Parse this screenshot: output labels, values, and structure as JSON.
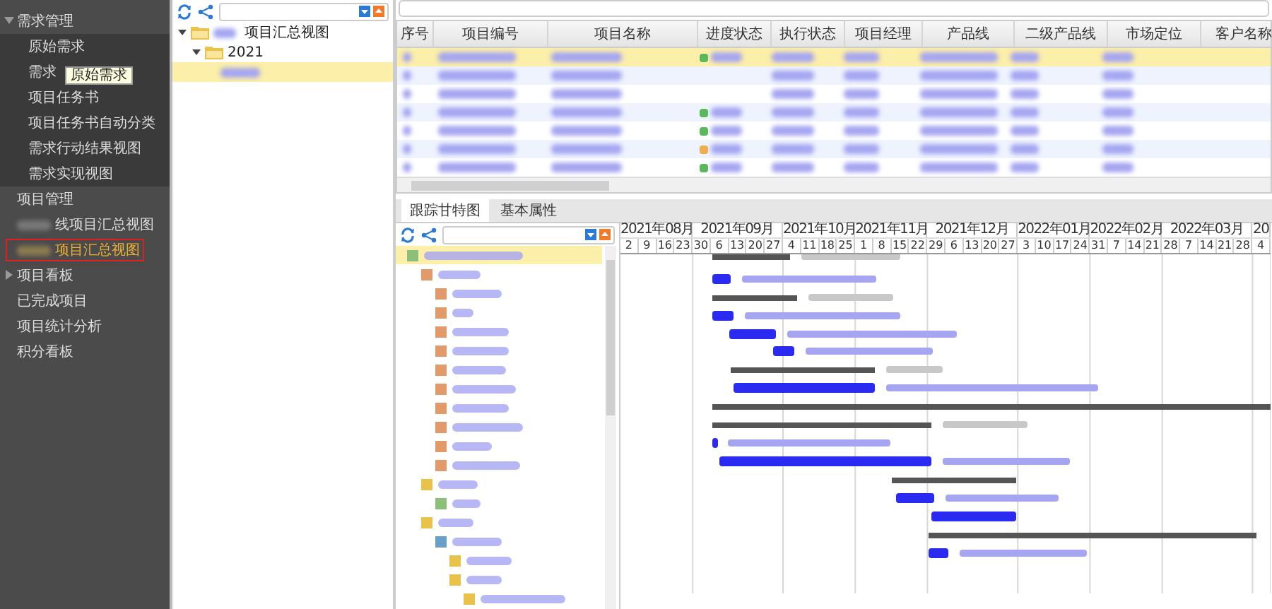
{
  "sidebar": {
    "items": [
      {
        "label": "需求管理",
        "expanded": true,
        "selected": false,
        "children": [
          {
            "label": "原始需求",
            "selected": false
          },
          {
            "label": "需求",
            "selected": false
          },
          {
            "label": "项目任务书",
            "selected": false
          },
          {
            "label": "项目任务书自动分类",
            "selected": false
          },
          {
            "label": "需求行动结果视图",
            "selected": false
          },
          {
            "label": "需求实现视图",
            "selected": false
          }
        ]
      },
      {
        "label": "项目管理",
        "selected": false,
        "children": [
          {
            "label": "线项目汇总视图",
            "redacted_prefix": true,
            "selected": false
          },
          {
            "label": "项目汇总视图",
            "redacted_prefix": true,
            "selected": true
          }
        ]
      },
      {
        "label": "项目看板",
        "expanded": false,
        "selected": false
      },
      {
        "label": "已完成项目",
        "selected": false
      },
      {
        "label": "项目统计分析",
        "selected": false
      },
      {
        "label": "积分看板",
        "selected": false
      }
    ],
    "tooltip": "原始需求"
  },
  "tree": {
    "nodes": [
      {
        "label": "项目汇总视图",
        "redacted_prefix": true,
        "expanded": true,
        "selected": false,
        "children": [
          {
            "label": "2021",
            "expanded": true,
            "selected": false,
            "children": [
              {
                "redacted_label": true,
                "selected": true
              }
            ]
          }
        ]
      }
    ]
  },
  "table": {
    "columns": [
      "序号",
      "项目编号",
      "项目名称",
      "进度状态",
      "执行状态",
      "项目经理",
      "产品线",
      "二级产品线",
      "市场定位",
      "客户名称"
    ],
    "rows": [
      {
        "selected": true,
        "color": "#5cb85c"
      },
      {
        "selected": false
      },
      {
        "selected": false
      },
      {
        "selected": false,
        "color": "#5cb85c"
      },
      {
        "selected": false,
        "color": "#5cb85c"
      },
      {
        "selected": false,
        "color": "#f0ad4e"
      },
      {
        "selected": false,
        "color": "#5cb85c"
      }
    ]
  },
  "tabs": [
    {
      "label": "跟踪甘特图",
      "selected": true
    },
    {
      "label": "基本属性",
      "selected": false
    }
  ],
  "gantt": {
    "months": [
      {
        "label": "2021年08月",
        "days": [
          "2",
          "9",
          "16",
          "23"
        ]
      },
      {
        "label": "2021年09月",
        "days": [
          "30",
          "6",
          "13",
          "20",
          "27"
        ]
      },
      {
        "label": "2021年10月",
        "days": [
          "4",
          "11",
          "18",
          "25"
        ]
      },
      {
        "label": "2021年11月",
        "days": [
          "1",
          "8",
          "15",
          "22"
        ]
      },
      {
        "label": "2021年12月",
        "days": [
          "29",
          "6",
          "13",
          "20",
          "27"
        ]
      },
      {
        "label": "2022年01月",
        "days": [
          "3",
          "10",
          "17",
          "24"
        ]
      },
      {
        "label": "2022年02月",
        "days": [
          "31",
          "7",
          "14",
          "21"
        ]
      },
      {
        "label": "2022年03月",
        "days": [
          "28",
          "7",
          "14",
          "21",
          "28"
        ]
      },
      {
        "label": "20",
        "days": [
          "4"
        ]
      }
    ]
  }
}
